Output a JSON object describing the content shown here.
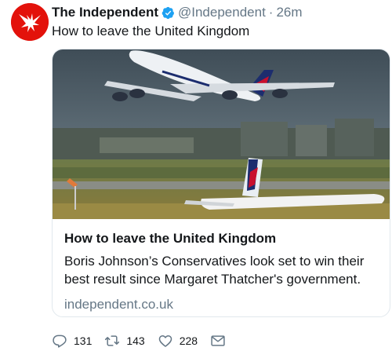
{
  "tweet": {
    "author_name": "The Independent",
    "handle": "@Independent",
    "separator": "·",
    "time": "26m",
    "text": "How to leave the United Kingdom",
    "verified": true
  },
  "card": {
    "image_icon": "photo-airplanes",
    "title": "How to leave the United Kingdom",
    "description": "Boris Johnson’s Conservatives look set to win their best result since Margaret Thatcher's government.",
    "domain": "independent.co.uk"
  },
  "actions": {
    "reply_count": "131",
    "retweet_count": "143",
    "like_count": "228"
  },
  "colors": {
    "brand_red": "#e3120b",
    "verified_blue": "#1da1f2",
    "secondary_text": "#657786"
  }
}
